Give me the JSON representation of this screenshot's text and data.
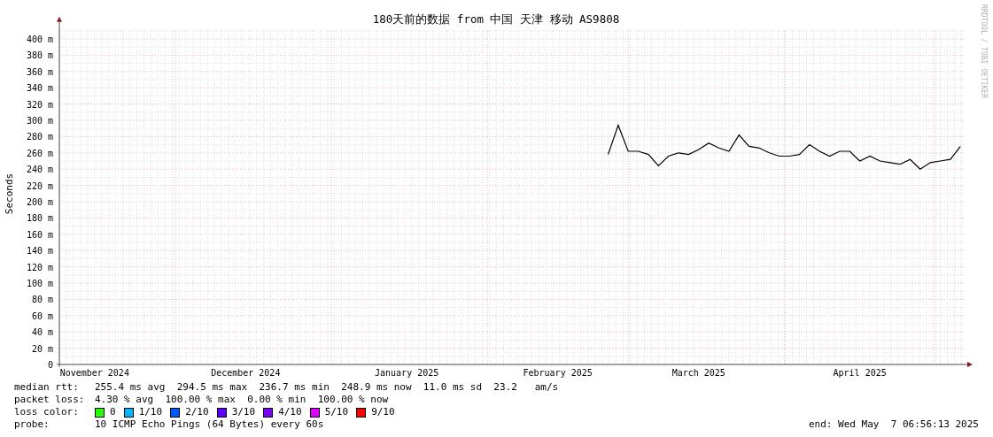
{
  "chart": {
    "watermark": "RRDTOOL / TOBI OETIKER",
    "chart_data": {
      "type": "line",
      "title": "180天前的数据 from 中国 天津 移动 AS9808",
      "ylabel": "Seconds",
      "categories": [
        null,
        null,
        null,
        "November 2024",
        null,
        null,
        null,
        null,
        null,
        null,
        null,
        null,
        null,
        null,
        null,
        null,
        null,
        null,
        "December 2024",
        null,
        null,
        null,
        null,
        null,
        null,
        null,
        null,
        null,
        null,
        null,
        null,
        null,
        null,
        null,
        "January 2025",
        null,
        null,
        null,
        null,
        null,
        null,
        null,
        null,
        null,
        null,
        null,
        null,
        null,
        null,
        "February 2025",
        null,
        null,
        null,
        null,
        null,
        null,
        null,
        null,
        null,
        null,
        null,
        null,
        null,
        "March 2025",
        null,
        null,
        null,
        null,
        null,
        null,
        null,
        null,
        null,
        null,
        null,
        null,
        null,
        null,
        null,
        "April 2025",
        null,
        null,
        null,
        null,
        null,
        null,
        null,
        null,
        null,
        null
      ],
      "ylim": [
        0,
        410
      ],
      "grid": true,
      "yticks": [
        {
          "value": 0,
          "label": "0"
        },
        {
          "value": 20,
          "label": "20 m"
        },
        {
          "value": 40,
          "label": "40 m"
        },
        {
          "value": 60,
          "label": "60 m"
        },
        {
          "value": 80,
          "label": "80 m"
        },
        {
          "value": 100,
          "label": "100 m"
        },
        {
          "value": 120,
          "label": "120 m"
        },
        {
          "value": 140,
          "label": "140 m"
        },
        {
          "value": 160,
          "label": "160 m"
        },
        {
          "value": 180,
          "label": "180 m"
        },
        {
          "value": 200,
          "label": "200 m"
        },
        {
          "value": 220,
          "label": "220 m"
        },
        {
          "value": 240,
          "label": "240 m"
        },
        {
          "value": 260,
          "label": "260 m"
        },
        {
          "value": 280,
          "label": "280 m"
        },
        {
          "value": 300,
          "label": "300 m"
        },
        {
          "value": 320,
          "label": "320 m"
        },
        {
          "value": 340,
          "label": "340 m"
        },
        {
          "value": 360,
          "label": "360 m"
        },
        {
          "value": 380,
          "label": "380 m"
        },
        {
          "value": 400,
          "label": "400 m"
        }
      ],
      "series": [
        {
          "name": "median rtt:",
          "color": "#000000",
          "values": [
            null,
            null,
            null,
            null,
            null,
            null,
            null,
            null,
            null,
            null,
            null,
            null,
            null,
            null,
            null,
            null,
            null,
            null,
            null,
            null,
            null,
            null,
            null,
            null,
            null,
            null,
            null,
            null,
            null,
            null,
            null,
            null,
            null,
            null,
            null,
            null,
            null,
            null,
            null,
            null,
            null,
            null,
            null,
            null,
            null,
            null,
            null,
            null,
            null,
            null,
            null,
            null,
            null,
            null,
            258,
            294,
            262,
            262,
            258,
            244,
            256,
            260,
            258,
            264,
            272,
            266,
            262,
            282,
            268,
            266,
            260,
            256,
            256,
            258,
            270,
            262,
            256,
            262,
            262,
            250,
            256,
            250,
            248,
            246,
            252,
            240,
            248,
            250,
            252,
            268
          ]
        }
      ]
    }
  },
  "legend": {
    "median_rtt": {
      "text": "255.4 ms avg  294.5 ms max  236.7 ms min  248.9 ms now  11.0 ms sd  23.2   am/s"
    },
    "packet_loss": {
      "label": "packet loss:",
      "text": "4.30 % avg  100.00 % max  0.00 % min  100.00 % now"
    },
    "loss_color": {
      "label": "loss color:",
      "items": [
        {
          "label": "0",
          "color": "#26ff00"
        },
        {
          "label": "1/10",
          "color": "#00b8ff"
        },
        {
          "label": "2/10",
          "color": "#0059ff"
        },
        {
          "label": "3/10",
          "color": "#5e00ff"
        },
        {
          "label": "4/10",
          "color": "#7e00ff"
        },
        {
          "label": "5/10",
          "color": "#dd00ff"
        },
        {
          "label": "9/10",
          "color": "#ff0000"
        }
      ]
    },
    "probe": {
      "label": "probe:",
      "text": "10 ICMP Echo Pings (64 Bytes) every 60s"
    },
    "end": "end: Wed May  7 06:56:13 2025"
  }
}
